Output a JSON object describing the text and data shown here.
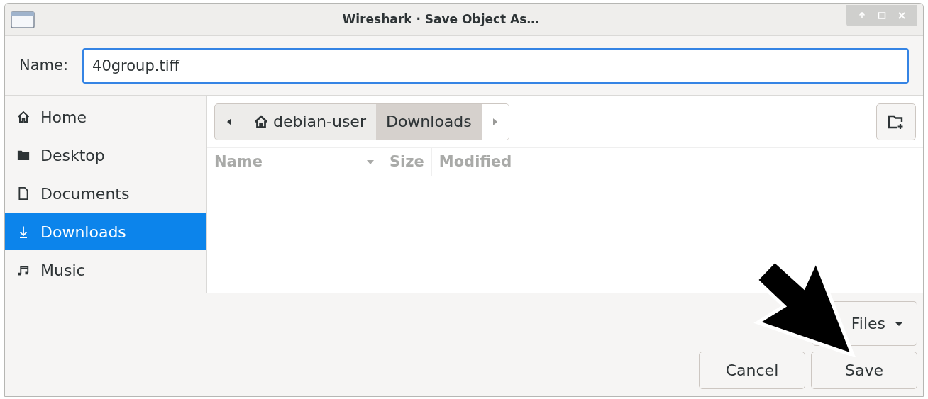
{
  "window": {
    "title": "Wireshark · Save Object As…"
  },
  "name_field": {
    "label": "Name:",
    "value": "40group.tiff"
  },
  "sidebar": {
    "items": [
      {
        "label": "Home",
        "kind": "home",
        "selected": false
      },
      {
        "label": "Desktop",
        "kind": "folder",
        "selected": false
      },
      {
        "label": "Documents",
        "kind": "document",
        "selected": false
      },
      {
        "label": "Downloads",
        "kind": "download",
        "selected": true
      },
      {
        "label": "Music",
        "kind": "music",
        "selected": false
      }
    ]
  },
  "path_bar": {
    "segments": [
      {
        "label": "debian-user",
        "kind": "home",
        "selected": false
      },
      {
        "label": "Downloads",
        "kind": "plain",
        "selected": true
      }
    ]
  },
  "file_list": {
    "columns": [
      {
        "label": "Name",
        "sorted": true
      },
      {
        "label": "Size",
        "sorted": false
      },
      {
        "label": "Modified",
        "sorted": false
      }
    ]
  },
  "filter_button": {
    "label": "Files"
  },
  "buttons": [
    "Cancel",
    "Save"
  ]
}
